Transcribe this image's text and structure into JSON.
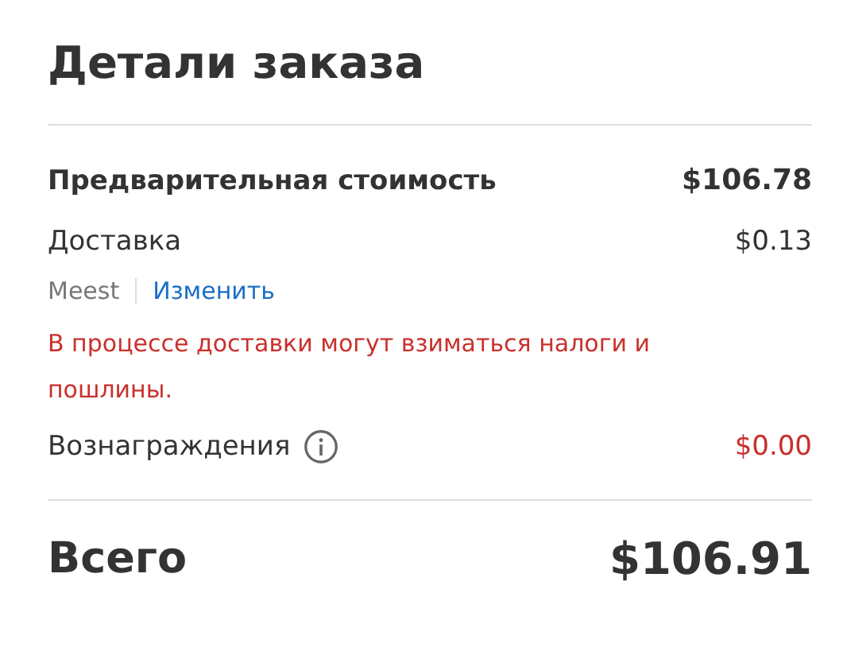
{
  "title": "Детали заказа",
  "subtotal": {
    "label": "Предварительная стоимость",
    "value": "$106.78"
  },
  "shipping": {
    "label": "Доставка",
    "value": "$0.13",
    "carrier": "Meest",
    "change_link": "Изменить",
    "notice": "В процессе доставки могут взиматься налоги и пошлины."
  },
  "rewards": {
    "label": "Вознаграждения",
    "value": "$0.00"
  },
  "total": {
    "label": "Всего",
    "value": "$106.91"
  }
}
